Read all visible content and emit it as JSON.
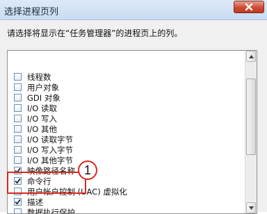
{
  "window": {
    "title": "选择进程页列"
  },
  "dialog": {
    "prompt": "请选择将显示在“任务管理器”的进程页上的列。"
  },
  "columns": [
    {
      "label": "线程数",
      "checked": false
    },
    {
      "label": "用户对象",
      "checked": false
    },
    {
      "label": "GDI 对象",
      "checked": false
    },
    {
      "label": "I/O 读取",
      "checked": false
    },
    {
      "label": "I/O 写入",
      "checked": false
    },
    {
      "label": "I/O 其他",
      "checked": false
    },
    {
      "label": "I/O 读取字节",
      "checked": false
    },
    {
      "label": "I/O 写入字节",
      "checked": false
    },
    {
      "label": "I/O 其他字节",
      "checked": false
    },
    {
      "label": "映像路径名称",
      "checked": true
    },
    {
      "label": "命令行",
      "checked": true
    },
    {
      "label": "用户帐户控制 (UAC) 虚拟化",
      "checked": false
    },
    {
      "label": "描述",
      "checked": true
    },
    {
      "label": "数据执行保护",
      "checked": false
    }
  ],
  "annotation": {
    "callout_number": "1",
    "color": "#d9281c"
  }
}
